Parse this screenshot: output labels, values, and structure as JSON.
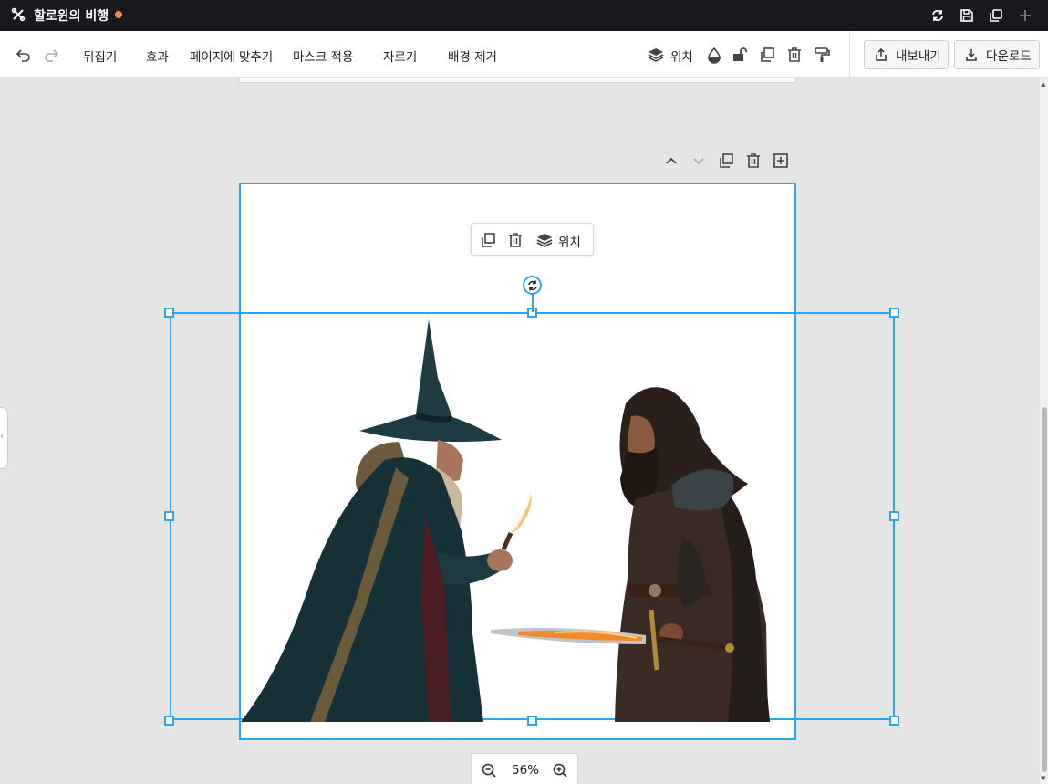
{
  "app": {
    "title": "할로윈의 비행",
    "unsaved_dot_color": "#f08a3c",
    "accent_color": "#2aa6f2"
  },
  "titlebar": {
    "icons": [
      "tools-logo-icon",
      "sync-icon",
      "save-icon",
      "duplicate-window-icon",
      "plus-icon"
    ]
  },
  "toolbar": {
    "flip_label": "뒤집기",
    "effects_label": "효과",
    "fit_page_label": "페이지에 맞추기",
    "mask_label": "마스크 적용",
    "crop_label": "자르기",
    "remove_bg_label": "배경 제거",
    "position_label": "위치",
    "export_label": "내보내기",
    "download_label": "다운로드"
  },
  "floating_toolbar": {
    "position_label": "위치"
  },
  "zoom": {
    "value": "56%"
  }
}
